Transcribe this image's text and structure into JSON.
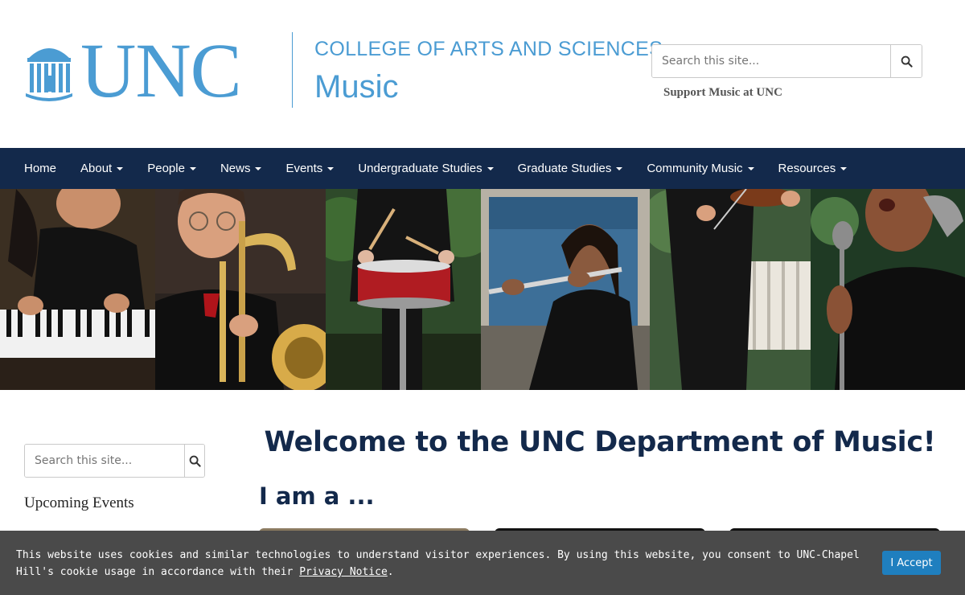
{
  "header": {
    "logo_text": "UNC",
    "college": "COLLEGE OF ARTS AND SCIENCES",
    "department": "Music",
    "search_placeholder": "Search this site...",
    "support_link": "Support Music at UNC"
  },
  "nav": {
    "items": [
      {
        "label": "Home",
        "dropdown": false
      },
      {
        "label": "About",
        "dropdown": true
      },
      {
        "label": "People",
        "dropdown": true
      },
      {
        "label": "News",
        "dropdown": true
      },
      {
        "label": "Events",
        "dropdown": true
      },
      {
        "label": "Undergraduate Studies",
        "dropdown": true
      },
      {
        "label": "Graduate Studies",
        "dropdown": true
      },
      {
        "label": "Community Music",
        "dropdown": true
      },
      {
        "label": "Resources",
        "dropdown": true
      }
    ]
  },
  "sidebar": {
    "search_placeholder": "Search this site...",
    "heading": "Upcoming Events"
  },
  "main": {
    "welcome": "Welcome to the UNC Department of Music!",
    "subheading": "I am a ..."
  },
  "cookie": {
    "text": "This website uses cookies and similar technologies to understand visitor experiences. By using this website, you consent to UNC-Chapel Hill's cookie usage in accordance with their ",
    "link": "Privacy Notice",
    "end": ".",
    "button": "I Accept"
  },
  "colors": {
    "brand_blue": "#4b9cd3",
    "navy": "#13294b",
    "cookie_bg": "#4a4a4a",
    "accept_blue": "#1f7fbf"
  },
  "icons": {
    "search": "search-icon",
    "logo": "old-well-icon",
    "caret": "caret-down-icon"
  }
}
